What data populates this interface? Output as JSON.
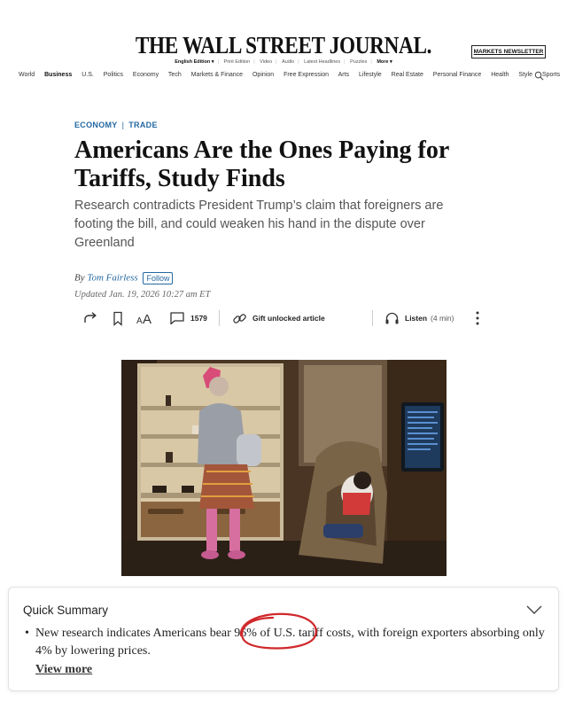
{
  "masthead": {
    "title": "THE WALL STREET JOURNAL.",
    "newsletter_button": "MARKETS NEWSLETTER",
    "edition_row": [
      "English Edition ▾",
      "Print Edition",
      "Video",
      "Audio",
      "Latest Headlines",
      "Puzzles",
      "More ▾"
    ]
  },
  "nav": {
    "items": [
      "World",
      "Business",
      "U.S.",
      "Politics",
      "Economy",
      "Tech",
      "Markets & Finance",
      "Opinion",
      "Free Expression",
      "Arts",
      "Lifestyle",
      "Real Estate",
      "Personal Finance",
      "Health",
      "Style",
      "Sports"
    ],
    "active": "Business"
  },
  "article": {
    "kicker_1": "ECONOMY",
    "kicker_2": "TRADE",
    "headline": "Americans Are the Ones Paying for Tariffs, Study Finds",
    "dek": "Research contradicts President Trump’s claim that foreigners are footing the bill, and could weaken his hand in the dispute over Greenland",
    "byline_prefix": "By",
    "author": "Tom Fairless",
    "follow_label": "Follow",
    "updated": "Updated Jan. 19, 2026 10:27 am ET"
  },
  "toolbar": {
    "comment_count": "1579",
    "gift_label": "Gift unlocked article",
    "listen_label": "Listen",
    "listen_duration": "(4 min)"
  },
  "summary": {
    "title": "Quick Summary",
    "bullet": "New research indicates Americans bear 96% of U.S. tariff costs, with foreign exporters absorbing only 4% by lowering prices.",
    "view_more": "View more",
    "highlight_color": "#d0282b"
  },
  "colors": {
    "accent_blue": "#2468a2"
  }
}
